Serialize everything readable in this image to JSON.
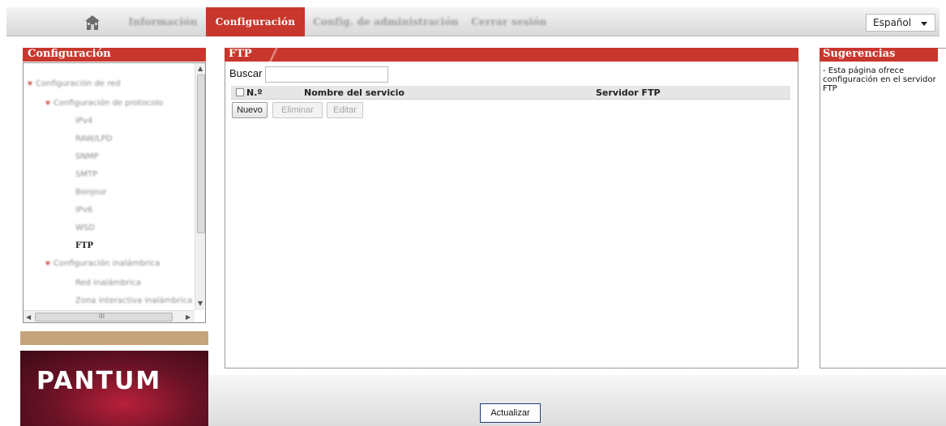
{
  "nav": {
    "items": [
      "Información",
      "Configuración",
      "Config. de administración",
      "Cerrar sesión"
    ],
    "active": "Configuración",
    "language": "Español"
  },
  "left": {
    "title": "Configuración",
    "tree": [
      "Configuración de red",
      "Configuración de protocolo",
      "IPv4",
      "RAW/LPD",
      "SNMP",
      "SMTP",
      "Bonjour",
      "IPv6",
      "WSD",
      "FTP",
      "Configuración inalámbrica",
      "Red inalámbrica",
      "Zona interactiva inalámbrica"
    ],
    "hscroll_mid": "III",
    "logo": "PANTUM"
  },
  "main": {
    "title": "FTP",
    "search_label": "Buscar",
    "search_value": "",
    "columns": [
      "N.º",
      "Nombre del servicio",
      "Servidor FTP"
    ],
    "buttons": {
      "new": "Nuevo",
      "delete": "Eliminar",
      "edit": "Editar"
    }
  },
  "right": {
    "title": "Sugerencias",
    "text": "- Esta página ofrece configuración en el servidor FTP"
  },
  "footer": {
    "refresh": "Actualizar"
  },
  "colors": {
    "accent_red": "#c8372d",
    "tan": "#c6a47c"
  }
}
